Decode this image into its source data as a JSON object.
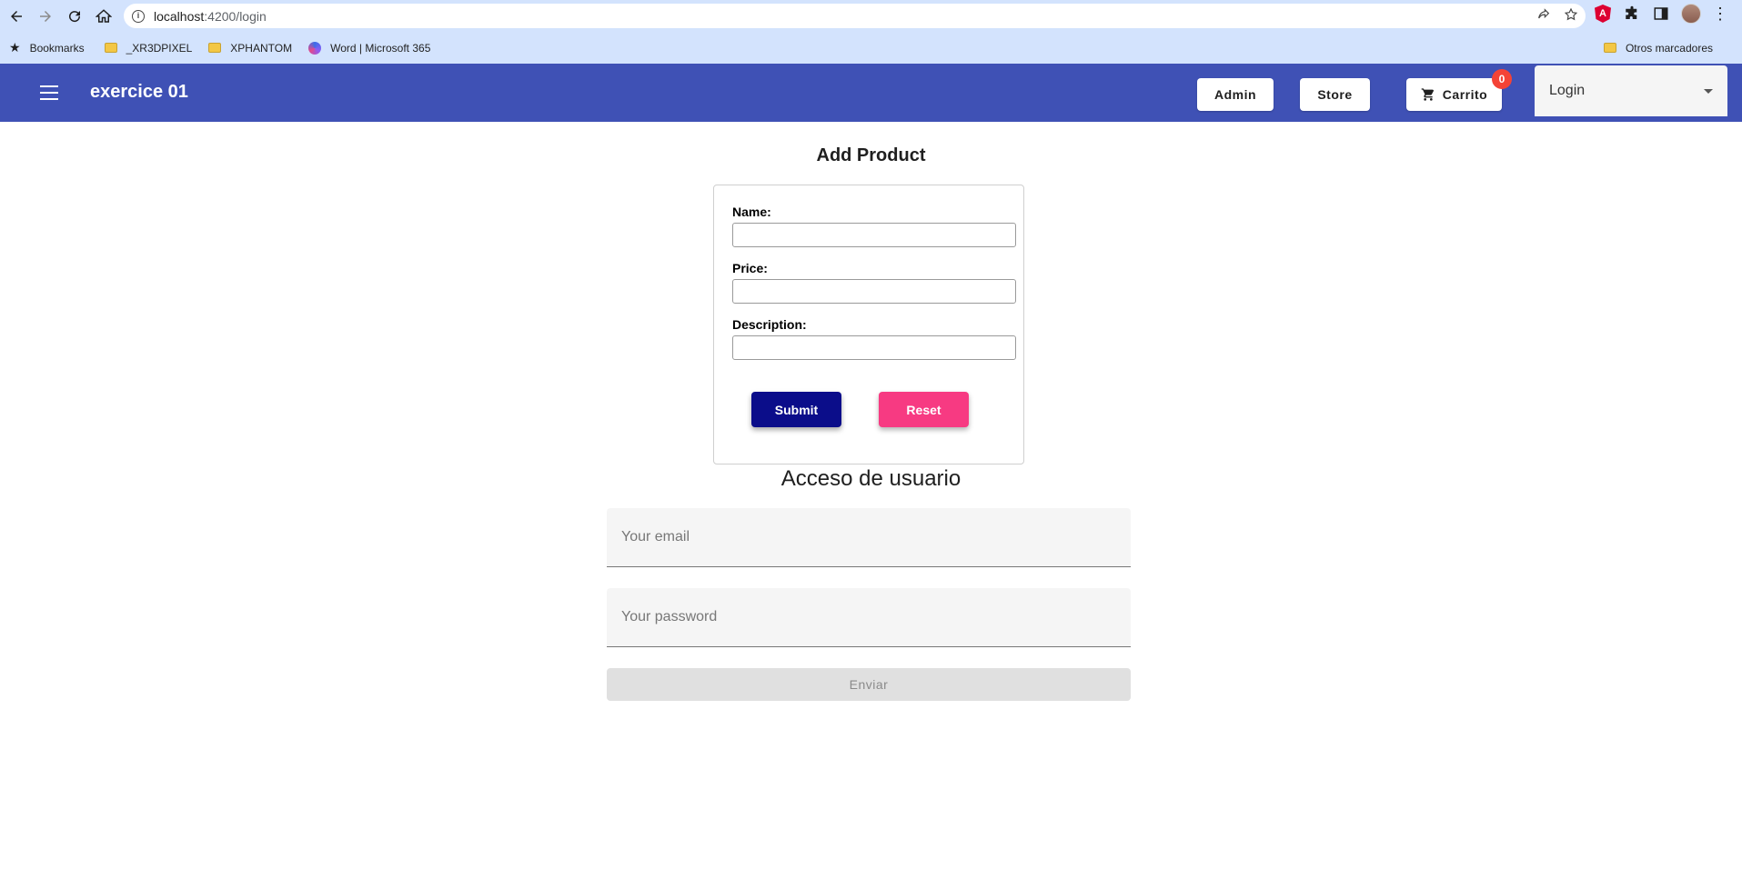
{
  "browser": {
    "url_host": "localhost",
    "url_path": ":4200/login",
    "bookmarks": [
      {
        "label": "Bookmarks",
        "icon": "star-icon"
      },
      {
        "label": "_XR3DPIXEL",
        "icon": "folder-icon"
      },
      {
        "label": "XPHANTOM",
        "icon": "folder-icon"
      },
      {
        "label": "Word | Microsoft 365",
        "icon": "word-icon"
      }
    ],
    "other_bookmarks": "Otros marcadores"
  },
  "toolbar": {
    "title": "exercice 01",
    "admin_label": "Admin",
    "store_label": "Store",
    "cart_label": "Carrito",
    "cart_count": "0",
    "login_select_value": "Login",
    "bg_color": "#3f51b5"
  },
  "product_form": {
    "title": "Add Product",
    "name_label": "Name:",
    "price_label": "Price:",
    "description_label": "Description:",
    "submit_label": "Submit",
    "reset_label": "Reset"
  },
  "login_form": {
    "title": "Acceso de usuario",
    "email_placeholder": "Your email",
    "password_placeholder": "Your password",
    "submit_label": "Enviar"
  }
}
